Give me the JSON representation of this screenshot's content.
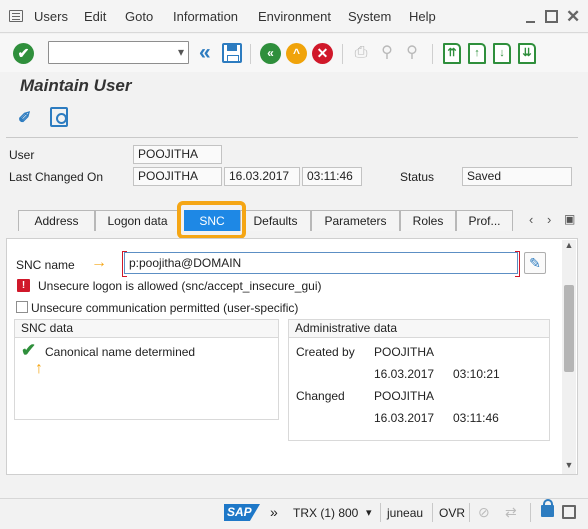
{
  "menubar": {
    "items": [
      "Users",
      "Edit",
      "Goto",
      "Information",
      "Environment",
      "System",
      "Help"
    ]
  },
  "toolbar": {
    "command_value": "",
    "icons": [
      "enter-icon",
      "command-field",
      "back-arrows-icon",
      "save-icon",
      "back-icon",
      "exit-icon",
      "cancel-icon",
      "print-icon",
      "find-icon",
      "find-next-icon",
      "first-page-icon",
      "previous-page-icon",
      "next-page-icon",
      "last-page-icon"
    ]
  },
  "screen": {
    "title": "Maintain User"
  },
  "header": {
    "user_label": "User",
    "user_value": "POOJITHA",
    "last_changed_label": "Last Changed On",
    "last_changed_by": "POOJITHA",
    "last_changed_date": "16.03.2017",
    "last_changed_time": "03:11:46",
    "status_label": "Status",
    "status_value": "Saved"
  },
  "tabs": [
    "Address",
    "Logon data",
    "SNC",
    "Defaults",
    "Parameters",
    "Roles",
    "Prof..."
  ],
  "active_tab": "SNC",
  "snc": {
    "snc_name_label": "SNC name",
    "snc_name_value": "p:poojitha@DOMAIN",
    "warning_text": "Unsecure logon is allowed (snc/accept_insecure_gui)",
    "checkbox_label": "Unsecure communication permitted (user-specific)",
    "checkbox_checked": false,
    "snc_data_title": "SNC data",
    "canonical_text": "Canonical name determined",
    "admin_title": "Administrative data",
    "created_by_label": "Created by",
    "created_by_value": "POOJITHA",
    "created_date": "16.03.2017",
    "created_time": "03:10:21",
    "changed_label": "Changed",
    "changed_by_value": "POOJITHA",
    "changed_date": "16.03.2017",
    "changed_time": "03:11:46"
  },
  "statusbar": {
    "logo": "SAP",
    "more": "»",
    "system": "TRX (1) 800",
    "host": "juneau",
    "mode": "OVR"
  },
  "colors": {
    "sap_blue": "#1e88e5",
    "highlight_orange": "#f5a615",
    "green": "#2f8f3c",
    "red": "#d0182a"
  }
}
